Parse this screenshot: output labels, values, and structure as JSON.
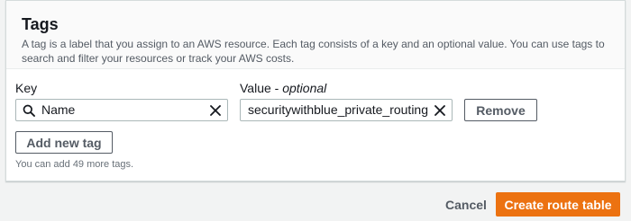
{
  "tags_panel": {
    "title": "Tags",
    "description": "A tag is a label that you assign to an AWS resource. Each tag consists of a key and an optional value. You can use tags to search and filter your resources or track your AWS costs.",
    "key_label": "Key",
    "value_label": "Value - ",
    "value_label_optional": "optional",
    "rows": [
      {
        "key": "Name",
        "value": "securitywithblue_private_routing",
        "remove_label": "Remove"
      }
    ],
    "add_new_tag_label": "Add new tag",
    "limit_note": "You can add 49 more tags."
  },
  "footer": {
    "cancel_label": "Cancel",
    "create_label": "Create route table"
  },
  "colors": {
    "primary": "#ec7211",
    "panel_header_bg": "#fafafa",
    "page_bg": "#f2f3f3",
    "border": "#aab7b8"
  },
  "icons": [
    "search-icon",
    "close-icon"
  ]
}
